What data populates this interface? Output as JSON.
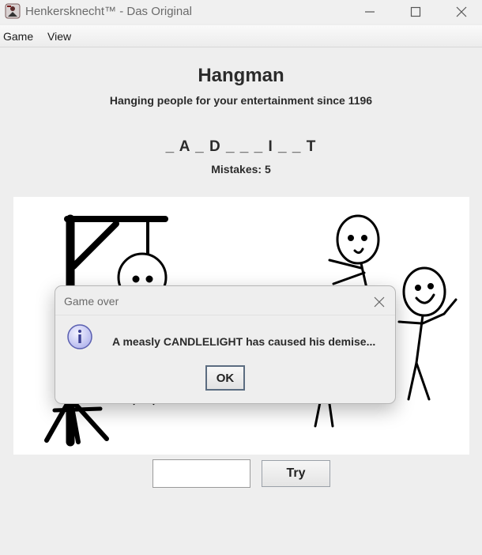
{
  "window": {
    "title": "Henkersknecht™ - Das Original",
    "icon": "hangman-app-icon",
    "controls": [
      "minimize-icon",
      "maximize-icon",
      "close-icon"
    ]
  },
  "menu": {
    "game": "Game",
    "view": "View"
  },
  "main": {
    "title": "Hangman",
    "subtitle": "Hanging people for your entertainment since 1196",
    "word_display": "_ A _ D _ _ _ I _ _ T",
    "mistakes_text": "Mistakes: 5"
  },
  "input": {
    "value": "",
    "placeholder": ""
  },
  "try_button": "Try",
  "dialog": {
    "title": "Game over",
    "icon": "info-icon",
    "message": "A measly CANDLELIGHT has caused his demise...",
    "ok_label": "OK"
  },
  "colors": {
    "accent_ok_border": "#5b6c80",
    "info_icon_fill": "#c9cbf4",
    "info_icon_stroke": "#5a5fb0"
  }
}
